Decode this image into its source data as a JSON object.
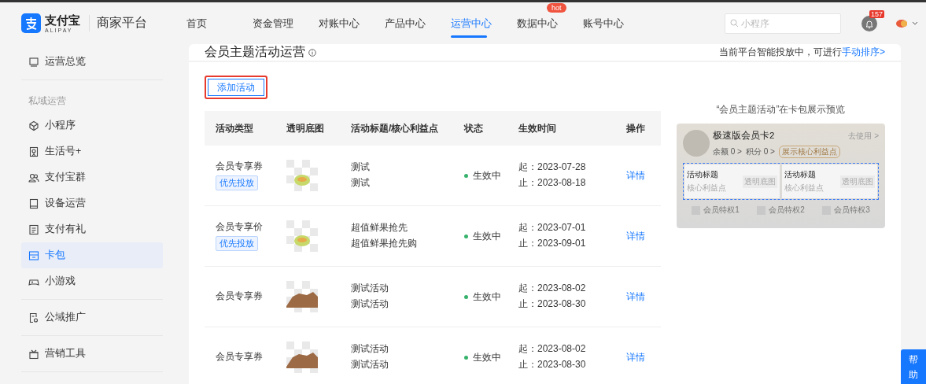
{
  "header": {
    "brand": "支付宝",
    "brand_sub": "ALIPAY",
    "platform": "商家平台",
    "nav": [
      {
        "label": "首页",
        "selected": false
      },
      {
        "label": "资金管理",
        "selected": false
      },
      {
        "label": "对账中心",
        "selected": false
      },
      {
        "label": "产品中心",
        "selected": false
      },
      {
        "label": "运营中心",
        "selected": true
      },
      {
        "label": "数据中心",
        "selected": false,
        "badge": "hot"
      },
      {
        "label": "账号中心",
        "selected": false
      }
    ],
    "search": {
      "placeholder": "小程序"
    },
    "notifications": "157"
  },
  "sidebar": {
    "groups": [
      {
        "items": [
          {
            "label": "运营总览",
            "selected": false
          }
        ]
      },
      {
        "title": "私域运营",
        "items": [
          {
            "label": "小程序",
            "selected": false
          },
          {
            "label": "生活号+",
            "selected": false
          },
          {
            "label": "支付宝群",
            "selected": false
          },
          {
            "label": "设备运营",
            "selected": false
          },
          {
            "label": "支付有礼",
            "selected": false
          },
          {
            "label": "卡包",
            "selected": true
          },
          {
            "label": "小游戏",
            "selected": false
          }
        ]
      },
      {
        "items": [
          {
            "label": "公域推广",
            "selected": false
          }
        ]
      },
      {
        "items": [
          {
            "label": "营销工具",
            "selected": false
          }
        ]
      }
    ]
  },
  "page": {
    "title": "会员主题活动运营",
    "notice": "当前平台智能投放中，可进行",
    "notice_link": "手动排序>",
    "add_button": {
      "label": "添加活动",
      "highlighted": true
    },
    "table": {
      "columns": [
        "活动类型",
        "透明底图",
        "活动标题/核心利益点",
        "状态",
        "生效时间",
        "操作"
      ],
      "rows": [
        {
          "type": "会员专享券",
          "tag": "优先投放",
          "kind": "melon",
          "title": "测试",
          "benefit": "测试",
          "status": "生效中",
          "start": "起：2023-07-28",
          "end": "止：2023-08-18",
          "action": "详情"
        },
        {
          "type": "会员专享价",
          "tag": "优先投放",
          "kind": "melon",
          "title": "超值鲜果抢先",
          "benefit": "超值鲜果抢先购",
          "status": "生效中",
          "start": "起：2023-07-01",
          "end": "止：2023-09-01",
          "action": "详情"
        },
        {
          "type": "会员专享券",
          "kind": "rock",
          "title": "测试活动",
          "benefit": "测试活动",
          "status": "生效中",
          "start": "起：2023-08-02",
          "end": "止：2023-08-30",
          "action": "详情"
        },
        {
          "type": "会员专享券",
          "kind": "rock",
          "title": "测试活动",
          "benefit": "测试活动",
          "status": "生效中",
          "start": "起：2023-08-02",
          "end": "止：2023-08-30",
          "action": "详情"
        }
      ]
    },
    "preview": {
      "caption": "“会员主题活动”在卡包展示预览",
      "card_name": "极速版会员卡2",
      "use": "去使用 >",
      "balance": "余额 0 >",
      "points": "积分 0 >",
      "benefit_tag": "展示核心利益点",
      "slots": [
        {
          "title": "活动标题",
          "sub": "核心利益点",
          "image": "透明底图"
        },
        {
          "title": "活动标题",
          "sub": "核心利益点",
          "image": "透明底图"
        }
      ],
      "perks": [
        "会员特权1",
        "会员特权2",
        "会员特权3"
      ]
    }
  },
  "help": "帮助"
}
